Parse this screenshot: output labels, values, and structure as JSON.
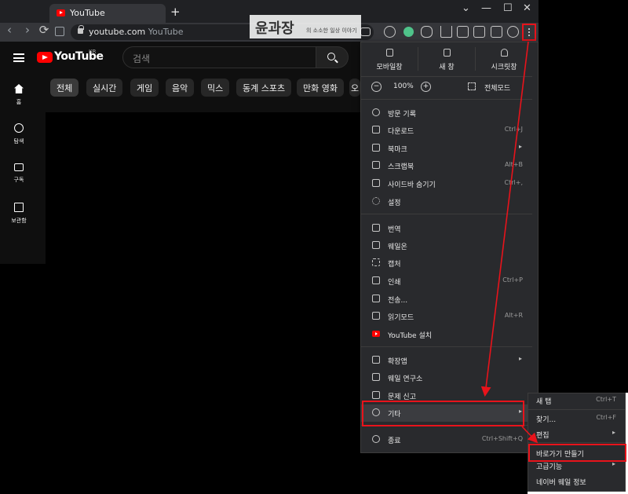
{
  "browser": {
    "tab_title": "YouTube",
    "new_tab": "+",
    "window_controls": [
      "⌄",
      "—",
      "☐",
      "✕"
    ],
    "nav": {
      "back": "‹",
      "forward": "›",
      "reload": "⟳"
    },
    "url_host": "youtube.com",
    "url_title": "YouTube",
    "menu_button_icon": "three-dots-vertical-icon"
  },
  "watermark": {
    "big": "윤과장",
    "small": "의 소소한 일상 이야기"
  },
  "youtube": {
    "logo_text": "YouTube",
    "region": "KR",
    "search_placeholder": "검색",
    "chips": [
      "전체",
      "실시간",
      "게임",
      "음악",
      "믹스",
      "동계 스포츠",
      "만화 영화",
      "오"
    ],
    "sidebar": [
      "홈",
      "탐색",
      "구독",
      "보관함"
    ]
  },
  "menu": {
    "quick": [
      "모바일창",
      "새 창",
      "시크릿창"
    ],
    "zoom": {
      "minus": "−",
      "value": "100%",
      "plus": "+",
      "fullscreen": "전체모드"
    },
    "group1": [
      {
        "label": "방문 기록",
        "shortcut": "",
        "arrow": false,
        "icon": "clock-icon"
      },
      {
        "label": "다운로드",
        "shortcut": "Ctrl+J",
        "arrow": false,
        "icon": "download-icon"
      },
      {
        "label": "북마크",
        "shortcut": "",
        "arrow": true,
        "icon": "star-icon"
      },
      {
        "label": "스크랩북",
        "shortcut": "Alt+B",
        "arrow": false,
        "icon": "scrapbook-icon"
      },
      {
        "label": "사이드바 숨기기",
        "shortcut": "Ctrl+,",
        "arrow": false,
        "icon": "sidebar-icon"
      },
      {
        "label": "설정",
        "shortcut": "",
        "arrow": false,
        "icon": "gear-icon"
      }
    ],
    "group2": [
      {
        "label": "번역",
        "shortcut": "",
        "arrow": false,
        "icon": "translate-icon"
      },
      {
        "label": "웨일온",
        "shortcut": "",
        "arrow": false,
        "icon": "video-call-icon"
      },
      {
        "label": "캡처",
        "shortcut": "",
        "arrow": false,
        "icon": "capture-icon"
      },
      {
        "label": "인쇄",
        "shortcut": "Ctrl+P",
        "arrow": false,
        "icon": "printer-icon"
      },
      {
        "label": "전송...",
        "shortcut": "",
        "arrow": false,
        "icon": "cast-icon"
      },
      {
        "label": "읽기모드",
        "shortcut": "Alt+R",
        "arrow": false,
        "icon": "book-icon"
      },
      {
        "label": "YouTube 설치",
        "shortcut": "",
        "arrow": false,
        "icon": "youtube-icon"
      }
    ],
    "group3": [
      {
        "label": "확장앱",
        "shortcut": "",
        "arrow": true,
        "icon": "extensions-icon"
      },
      {
        "label": "웨일 연구소",
        "shortcut": "",
        "arrow": false,
        "icon": "flask-icon"
      },
      {
        "label": "문제 신고",
        "shortcut": "",
        "arrow": false,
        "icon": "report-icon"
      },
      {
        "label": "기타",
        "shortcut": "",
        "arrow": true,
        "icon": "more-circle-icon"
      }
    ],
    "exit": {
      "label": "종료",
      "shortcut": "Ctrl+Shift+Q",
      "icon": "power-icon"
    }
  },
  "submenu": [
    {
      "label": "새 탭",
      "shortcut": "Ctrl+T",
      "arrow": false
    },
    {
      "label": "찾기...",
      "shortcut": "Ctrl+F",
      "arrow": false
    },
    {
      "label": "편집",
      "shortcut": "",
      "arrow": true
    },
    {
      "label": "바로가기 만들기",
      "shortcut": "",
      "arrow": false
    },
    {
      "label": "고급기능",
      "shortcut": "",
      "arrow": true
    },
    {
      "label": "네이버 웨일 정보",
      "shortcut": "",
      "arrow": false
    }
  ],
  "colors": {
    "highlight_red": "#e8131b",
    "menu_bg": "#292a2d",
    "page_bg": "#0f0f0f",
    "youtube_red": "#ff0000"
  }
}
